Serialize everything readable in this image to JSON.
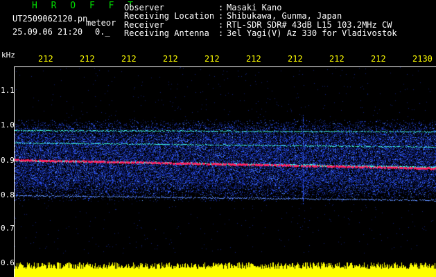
{
  "header": {
    "brand": "H R O F F T",
    "filename": "UT2509062120.pn",
    "type_tag": "meteor",
    "timestamp": "25.09.06 21:20",
    "timestamp_value": "0._"
  },
  "info": [
    {
      "label": "Observer",
      "sep": ":",
      "value": "Masaki Kano"
    },
    {
      "label": "Receiving Location",
      "sep": ":",
      "value": "Shibukawa, Gunma, Japan"
    },
    {
      "label": "Receiver",
      "sep": ":",
      "value": "RTL-SDR SDR# 43dB L15 103.2MHz CW"
    },
    {
      "label": "Receiving Antenna",
      "sep": ":",
      "value": "3el Yagi(V) Az 330 for Vladivostok"
    }
  ],
  "axes": {
    "y_unit": "kHz",
    "y_ticks": [
      "1.1",
      "1.0",
      "0.9",
      "0.8",
      "0.7",
      "0.6"
    ],
    "x_ticks": [
      "212",
      "212",
      "212",
      "212",
      "212",
      "212",
      "212",
      "212",
      "212",
      "2130"
    ]
  },
  "colors": {
    "brand": "#00e000",
    "tick_label": "#ffff00",
    "noise_dark": "#10207a",
    "noise_mid": "#2f58ff",
    "line_cyan": "#40ffe0",
    "line_red": "#ff2060",
    "amplitude": "#ffff00"
  }
}
